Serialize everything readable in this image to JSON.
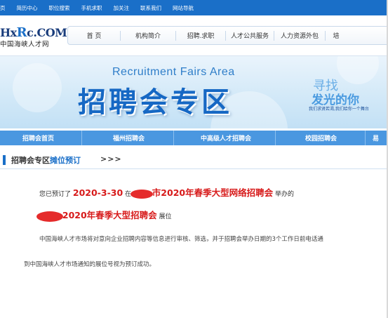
{
  "top_nav": [
    "页",
    "简历中心",
    "职位搜索",
    "手机求职",
    "加关注",
    "联系我们",
    "网站导航"
  ],
  "logo": {
    "main_prefix": "H",
    "main_x": "x",
    "main_r": "R",
    "main_c": "c",
    "main_suffix": ".COM",
    "sub": "中国海峡人才网"
  },
  "main_nav": [
    "首 页",
    "机构简介",
    "招聘.求职",
    "人才公共服务",
    "人力资源外包",
    "培"
  ],
  "banner": {
    "en": "Recruitment Fairs Area",
    "cn": "招聘会专区",
    "right_line1": "寻找",
    "right_line2": "发光的你",
    "right_line3": "我们求贤若渴,我们给你一个舞台"
  },
  "sub_nav": [
    "招聘会首页",
    "福州招聘会",
    "中高级人才招聘会",
    "校园招聘会",
    "易"
  ],
  "breadcrumb": {
    "title": "招聘会专区",
    "highlight": "摊位预订",
    "arrows": ">>>"
  },
  "content": {
    "prefix": "您已预订了",
    "date": "2020-3-30",
    "at": "在",
    "fair_suffix": "市2020年春季大型网络招聘会",
    "held": "举办的",
    "booth_text": "2020年春季大型招聘会",
    "booth_suffix": "展位",
    "notice1": "中国海峡人才市场将对意向企业招聘内容等信息进行审核、筛选，并于招聘会举办日期的3个工作日前电话通",
    "notice2": "到中国海峡人才市场通知的展位号视为预订成功。"
  },
  "colors": {
    "primary": "#1a6fc8",
    "sub_nav": "#4a97e0",
    "accent_red": "#d71a1a"
  }
}
